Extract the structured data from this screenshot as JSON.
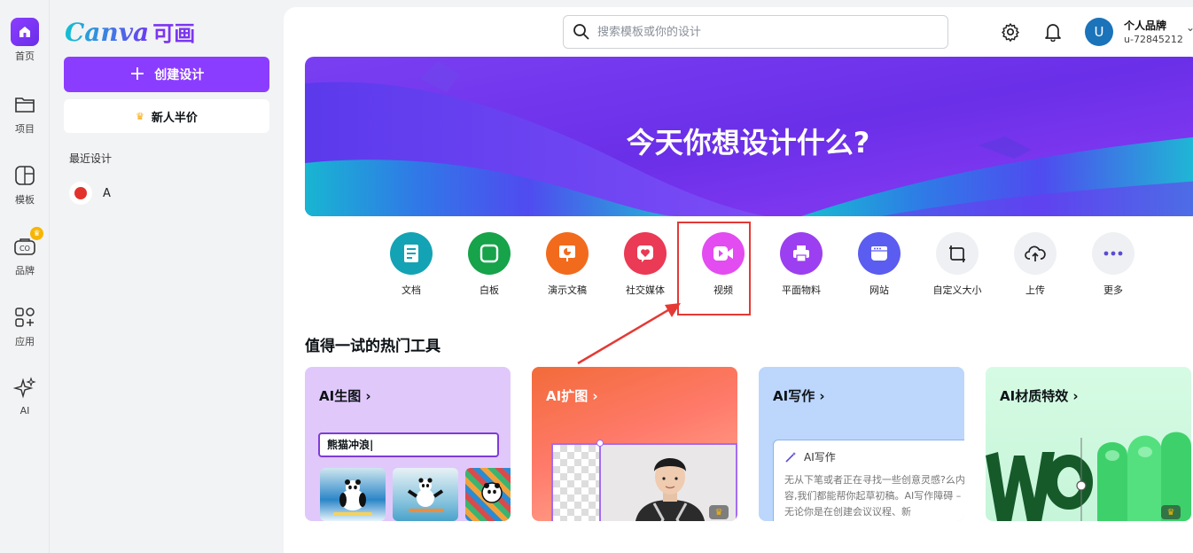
{
  "rail": {
    "items": [
      {
        "label": "首页",
        "icon": "home-icon"
      },
      {
        "label": "项目",
        "icon": "folder-icon"
      },
      {
        "label": "模板",
        "icon": "template-icon"
      },
      {
        "label": "品牌",
        "icon": "brand-icon"
      },
      {
        "label": "应用",
        "icon": "apps-icon"
      },
      {
        "label": "AI",
        "icon": "sparkle-icon"
      }
    ],
    "accent": "#8b3dff"
  },
  "panel": {
    "logo_text": "Canva",
    "logo_cn": "可画",
    "create_label": "创建设计",
    "promo_label": "新人半价",
    "recent_title": "最近设计",
    "recent_items": [
      {
        "label": "A"
      }
    ]
  },
  "header": {
    "search_placeholder": "搜索模板或你的设计",
    "avatar_letter": "U",
    "account_name": "个人品牌",
    "account_id": "u-72845212"
  },
  "hero": {
    "title": "今天你想设计什么?"
  },
  "categories": [
    {
      "label": "文档",
      "color": "#13a3b4",
      "icon": "doc-icon"
    },
    {
      "label": "白板",
      "color": "#16a34a",
      "icon": "whiteboard-icon"
    },
    {
      "label": "演示文稿",
      "color": "#f26b1d",
      "icon": "presentation-icon"
    },
    {
      "label": "社交媒体",
      "color": "#ea3a55",
      "icon": "social-heart-icon"
    },
    {
      "label": "视频",
      "color": "#e34cf0",
      "icon": "video-icon"
    },
    {
      "label": "平面物料",
      "color": "#9b3ff0",
      "icon": "print-icon"
    },
    {
      "label": "网站",
      "color": "#5b5cf0",
      "icon": "website-icon"
    },
    {
      "label": "自定义大小",
      "color": "#eef0f3",
      "icon": "custom-size-icon"
    },
    {
      "label": "上传",
      "color": "#eef0f3",
      "icon": "upload-cloud-icon"
    },
    {
      "label": "更多",
      "color": "#eef0f3",
      "icon": "more-icon"
    }
  ],
  "section": {
    "title": "值得一试的热门工具"
  },
  "tools": [
    {
      "title": "AI生图 ›",
      "input_value": "熊猫冲浪"
    },
    {
      "title": "AI扩图 ›"
    },
    {
      "title": "AI写作 ›",
      "panel_title": "AI写作",
      "panel_text": "无从下笔或者正在寻找一些创意灵感?么内容,我们都能帮你起草初稿。AI写作障碍 – 无论你是在创建会议议程、新"
    },
    {
      "title": "AI材质特效 ›"
    }
  ]
}
